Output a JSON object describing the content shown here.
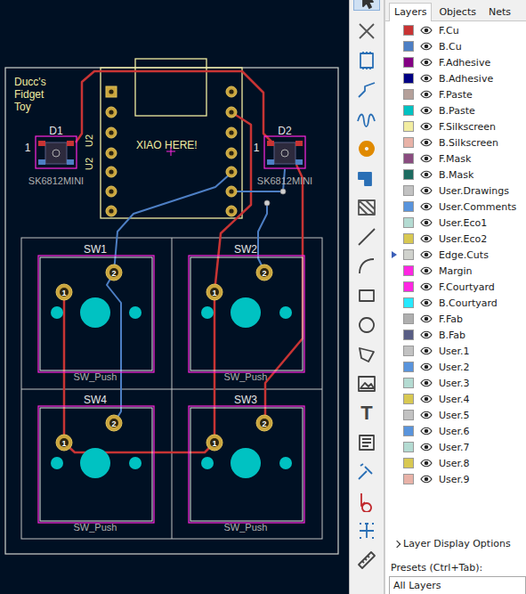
{
  "board": {
    "title": [
      "Ducc's",
      "Fidget",
      "Toy"
    ],
    "module": {
      "refs": [
        "U2",
        "U2"
      ],
      "note": "XIAO HERE!"
    },
    "leds": [
      {
        "ref": "D1",
        "value": "SK6812MINI",
        "pin": "1"
      },
      {
        "ref": "D2",
        "value": "SK6812MINI",
        "pin": "1"
      }
    ],
    "switches": [
      {
        "ref": "SW1",
        "value": "SW_Push",
        "pads": [
          "1",
          "2"
        ]
      },
      {
        "ref": "SW2",
        "value": "SW_Push",
        "pads": [
          "1",
          "2"
        ]
      },
      {
        "ref": "SW4",
        "value": "SW_Push",
        "pads": [
          "1",
          "2"
        ]
      },
      {
        "ref": "SW3",
        "value": "SW_Push",
        "pads": [
          "1",
          "2"
        ]
      }
    ]
  },
  "toolbar": {
    "text_tool_icon": "T"
  },
  "tabs": [
    {
      "label": "Layers",
      "selected": true
    },
    {
      "label": "Objects",
      "selected": false
    },
    {
      "label": "Nets",
      "selected": false
    }
  ],
  "layers": [
    {
      "name": "F.Cu",
      "color": "#c83434",
      "visible": true,
      "selected": false
    },
    {
      "name": "B.Cu",
      "color": "#4d7fc4",
      "visible": true,
      "selected": false
    },
    {
      "name": "F.Adhesive",
      "color": "#840084",
      "visible": true,
      "selected": false
    },
    {
      "name": "B.Adhesive",
      "color": "#000084",
      "visible": true,
      "selected": false
    },
    {
      "name": "F.Paste",
      "color": "#b4a09a",
      "visible": true,
      "selected": false
    },
    {
      "name": "B.Paste",
      "color": "#00c2c2",
      "visible": true,
      "selected": false
    },
    {
      "name": "F.Silkscreen",
      "color": "#f2eda1",
      "visible": true,
      "selected": false
    },
    {
      "name": "B.Silkscreen",
      "color": "#e8b2a7",
      "visible": true,
      "selected": false
    },
    {
      "name": "F.Mask",
      "color": "#8a4c80",
      "visible": true,
      "selected": false
    },
    {
      "name": "B.Mask",
      "color": "#1d6b60",
      "visible": true,
      "selected": false
    },
    {
      "name": "User.Drawings",
      "color": "#c2c2c2",
      "visible": true,
      "selected": false
    },
    {
      "name": "User.Comments",
      "color": "#5994dc",
      "visible": true,
      "selected": false
    },
    {
      "name": "User.Eco1",
      "color": "#b4dbd2",
      "visible": true,
      "selected": false
    },
    {
      "name": "User.Eco2",
      "color": "#d8c852",
      "visible": true,
      "selected": false
    },
    {
      "name": "Edge.Cuts",
      "color": "#d0d2cd",
      "visible": true,
      "selected": true
    },
    {
      "name": "Margin",
      "color": "#ff26e2",
      "visible": true,
      "selected": false
    },
    {
      "name": "F.Courtyard",
      "color": "#ff26e2",
      "visible": true,
      "selected": false
    },
    {
      "name": "B.Courtyard",
      "color": "#26e9ff",
      "visible": true,
      "selected": false
    },
    {
      "name": "F.Fab",
      "color": "#afafaf",
      "visible": true,
      "selected": false
    },
    {
      "name": "B.Fab",
      "color": "#585d84",
      "visible": true,
      "selected": false
    },
    {
      "name": "User.1",
      "color": "#c2c2c2",
      "visible": true,
      "selected": false
    },
    {
      "name": "User.2",
      "color": "#5994dc",
      "visible": true,
      "selected": false
    },
    {
      "name": "User.3",
      "color": "#b4dbd2",
      "visible": true,
      "selected": false
    },
    {
      "name": "User.4",
      "color": "#d8c852",
      "visible": true,
      "selected": false
    },
    {
      "name": "User.5",
      "color": "#c2c2c2",
      "visible": true,
      "selected": false
    },
    {
      "name": "User.6",
      "color": "#5994dc",
      "visible": true,
      "selected": false
    },
    {
      "name": "User.7",
      "color": "#b4dbd2",
      "visible": true,
      "selected": false
    },
    {
      "name": "User.8",
      "color": "#d8c852",
      "visible": true,
      "selected": false
    },
    {
      "name": "User.9",
      "color": "#e8b2a7",
      "visible": true,
      "selected": false
    }
  ],
  "display_options": {
    "label": "Layer Display Options",
    "expanded": false
  },
  "presets": {
    "label": "Presets (Ctrl+Tab):",
    "value": "All Layers"
  }
}
